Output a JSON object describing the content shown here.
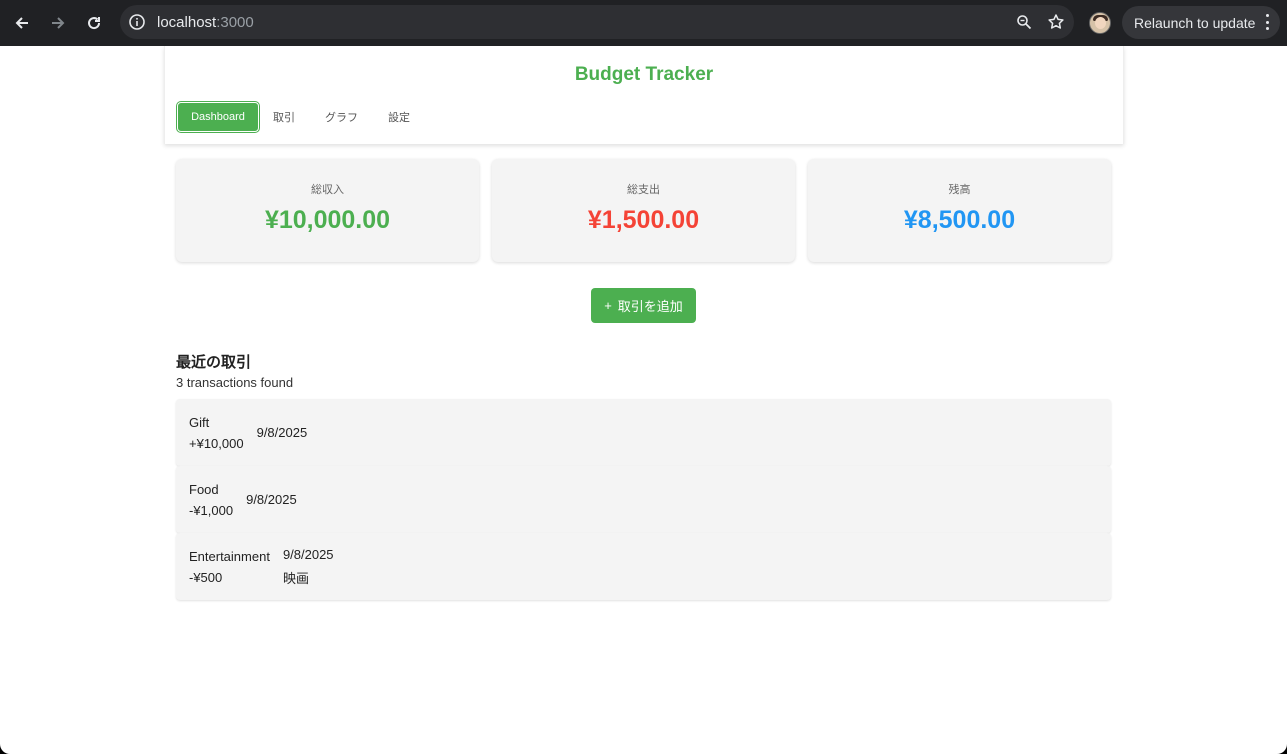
{
  "browser": {
    "url_host": "localhost",
    "url_port": ":3000",
    "relaunch_label": "Relaunch to update"
  },
  "header": {
    "title": "Budget Tracker",
    "tabs": [
      {
        "label": "Dashboard",
        "active": true
      },
      {
        "label": "取引",
        "active": false
      },
      {
        "label": "グラフ",
        "active": false
      },
      {
        "label": "設定",
        "active": false
      }
    ]
  },
  "summary": {
    "income": {
      "label": "総収入",
      "value": "¥10,000.00",
      "color": "#4caf50"
    },
    "expense": {
      "label": "総支出",
      "value": "¥1,500.00",
      "color": "#f44336"
    },
    "balance": {
      "label": "残高",
      "value": "¥8,500.00",
      "color": "#2196f3"
    }
  },
  "add_button": {
    "icon": "+",
    "label": "取引を追加"
  },
  "recent": {
    "title": "最近の取引",
    "count_text": "3 transactions found",
    "items": [
      {
        "category": "Gift",
        "amount": "+¥10,000",
        "date": "9/8/2025",
        "note": ""
      },
      {
        "category": "Food",
        "amount": "-¥1,000",
        "date": "9/8/2025",
        "note": ""
      },
      {
        "category": "Entertainment",
        "amount": "-¥500",
        "date": "9/8/2025",
        "note": "映画"
      }
    ]
  },
  "colors": {
    "accent": "#4caf50",
    "expense": "#f44336",
    "balance": "#2196f3"
  }
}
